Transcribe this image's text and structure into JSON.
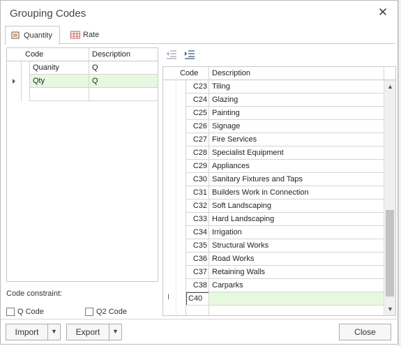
{
  "window": {
    "title": "Grouping Codes",
    "close_glyph": "✕"
  },
  "tabs": [
    {
      "label": "Quantity",
      "icon": "quantity-icon",
      "active": true
    },
    {
      "label": "Rate",
      "icon": "rate-table-icon",
      "active": false
    }
  ],
  "left_grid": {
    "columns": [
      "Code",
      "Description"
    ],
    "rows": [
      {
        "code": "Quanity",
        "description": "Q"
      },
      {
        "code": "Qty",
        "description": "Q"
      }
    ]
  },
  "constraint": {
    "label": "Code constraint:",
    "q_code_label": "Q Code",
    "q2_code_label": "Q2 Code"
  },
  "right_grid": {
    "columns": [
      "Code",
      "Description"
    ],
    "rows": [
      {
        "code": "C23",
        "description": "Tiling"
      },
      {
        "code": "C24",
        "description": "Glazing"
      },
      {
        "code": "C25",
        "description": "Painting"
      },
      {
        "code": "C26",
        "description": "Signage"
      },
      {
        "code": "C27",
        "description": "Fire Services"
      },
      {
        "code": "C28",
        "description": "Specialist Equipment"
      },
      {
        "code": "C29",
        "description": "Appliances"
      },
      {
        "code": "C30",
        "description": "Sanitary Fixtures and Taps"
      },
      {
        "code": "C31",
        "description": "Builders Work in Connection"
      },
      {
        "code": "C32",
        "description": "Soft Landscaping"
      },
      {
        "code": "C33",
        "description": "Hard Landscaping"
      },
      {
        "code": "C34",
        "description": "Irrigation"
      },
      {
        "code": "C35",
        "description": "Structural Works"
      },
      {
        "code": "C36",
        "description": "Road Works"
      },
      {
        "code": "C37",
        "description": "Retaining Walls"
      },
      {
        "code": "C38",
        "description": "Carparks"
      }
    ],
    "editing_value": "C40",
    "row_cursor_glyph": "I"
  },
  "buttons": {
    "import_label": "Import",
    "export_label": "Export",
    "close_label": "Close"
  },
  "colors": {
    "selected_row": "#e6f9e0",
    "rate_icon": "#d06060",
    "quantity_icon": "#e3b24a"
  }
}
